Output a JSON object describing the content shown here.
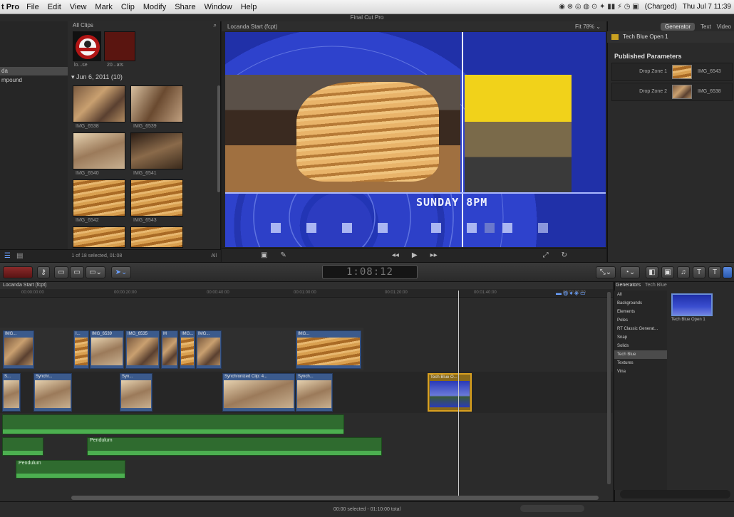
{
  "menubar": {
    "app": "t Pro",
    "menus": [
      "File",
      "Edit",
      "View",
      "Mark",
      "Clip",
      "Modify",
      "Share",
      "Window",
      "Help"
    ],
    "battery": "(Charged)",
    "clock": "Thu Jul 7  11:39"
  },
  "window_title": "Final Cut Pro",
  "browser": {
    "header_left": "All Clips",
    "library_rows": [
      "da",
      "mpound"
    ],
    "date_group": "▾  Jun 6, 2011  (10)",
    "thumb_top_labels": [
      "lo...se",
      "20...ats"
    ],
    "clip_labels": [
      "IMG_6538",
      "IMG_6539",
      "IMG_6540",
      "IMG_6541",
      "IMG_6542",
      "IMG_6543"
    ],
    "footer": "1 of 18 selected, 01:08",
    "footer_right": "All"
  },
  "viewer": {
    "title": "Locanda Start (fcpt)",
    "zoom": "Fit  78% ⌄",
    "overlay_text": "SUNDAY 8PM"
  },
  "inspector": {
    "tabs": [
      "Generator",
      "Text",
      "Video"
    ],
    "title": "Tech Blue Open 1",
    "published": "Published Parameters",
    "drop_zones": [
      {
        "label": "Drop Zone 1",
        "file": "IMG_6543"
      },
      {
        "label": "Drop Zone 2",
        "file": "IMG_6538"
      }
    ]
  },
  "toolbar": {
    "timecode": "1:08:12"
  },
  "timeline": {
    "project": "Locanda Start (fcpt)",
    "ruler_ticks": [
      "00:00:00:00",
      "00:00:20:00",
      "00:00:40:00",
      "00:01:00:00",
      "00:01:20:00",
      "00:01:40:00",
      "00:02:00:00"
    ],
    "connected_clips": [
      "IMG...",
      "I...",
      "IMG_6539",
      "IMG_6535",
      "M",
      "IMG...",
      "IMG..."
    ],
    "primary_clips": [
      "S...",
      "Synchr...",
      "Syn...",
      "Synchronized Clip: 4...",
      "Synch...",
      "Tech Blue O..."
    ],
    "audio_clips": [
      "Pendulum",
      "Pendulum"
    ],
    "status": "00:00 selected - 01:10:00 total"
  },
  "generators": {
    "header": "Generators",
    "breadcrumb": "Tech Blue",
    "categories": [
      "All",
      "Backgrounds",
      "Elements",
      "Poles",
      "RT Classic Generat...",
      "Snap",
      "Solids",
      "Tech Blue",
      "Textures",
      "Vina"
    ],
    "selected": "Tech Blue",
    "item_label": "Tech Blue Open 1"
  }
}
